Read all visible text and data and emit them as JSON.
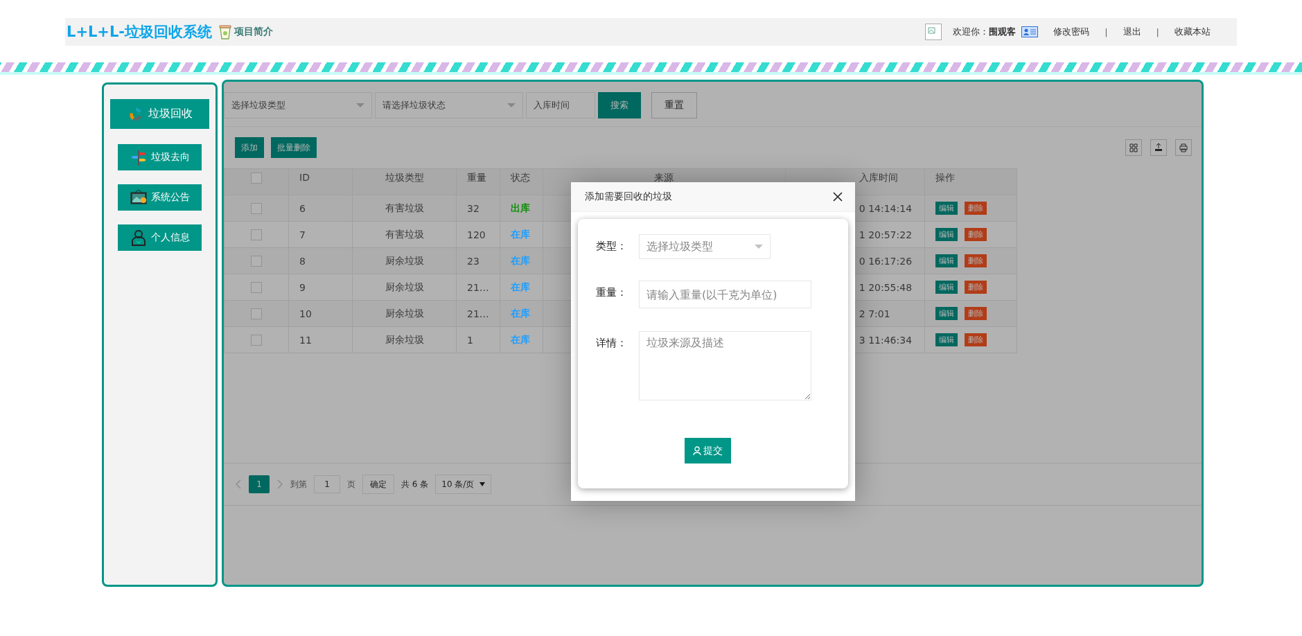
{
  "header": {
    "title": "L+L+L-垃圾回收系统",
    "intro_link": "项目简介",
    "welcome": "欢迎你：",
    "user": "围观客",
    "links": [
      "修改密码",
      "退出",
      "收藏本站"
    ],
    "separator": "|"
  },
  "sidebar": {
    "items": [
      {
        "label": "垃圾回收",
        "kind": "main"
      },
      {
        "label": "垃圾去向",
        "kind": "sub"
      },
      {
        "label": "系统公告",
        "kind": "sub"
      },
      {
        "label": "个人信息",
        "kind": "sub"
      }
    ]
  },
  "filters": {
    "type_placeholder": "选择垃圾类型",
    "status_placeholder": "请选择垃圾状态",
    "date_placeholder": "入库时间",
    "search": "搜索",
    "reset": "重置"
  },
  "toolbar": {
    "buttons": [
      "添加",
      "批量删除"
    ]
  },
  "table": {
    "all_checked": false,
    "columns": [
      "ID",
      "垃圾类型",
      "重量",
      "状态",
      "来源",
      "入库时间",
      "操作"
    ],
    "rows": [
      {
        "checked": false,
        "id": "6",
        "type": "有害垃圾",
        "weight": "32",
        "status": "出库",
        "color": "#0e8f08",
        "time": "0 14:14:14",
        "actions": [
          "编辑",
          "删除"
        ]
      },
      {
        "checked": false,
        "id": "7",
        "type": "有害垃圾",
        "weight": "120",
        "status": "在库",
        "color": "#1e9fff",
        "time": "1 20:57:22",
        "actions": [
          "编辑",
          "删除"
        ]
      },
      {
        "checked": false,
        "id": "8",
        "type": "厨余垃圾",
        "weight": "23",
        "status": "在库",
        "color": "#1e9fff",
        "time": "0 16:17:26",
        "actions": [
          "编辑",
          "删除"
        ]
      },
      {
        "checked": false,
        "id": "9",
        "type": "厨余垃圾",
        "weight": "21…",
        "status": "在库",
        "color": "#1e9fff",
        "time": "1 20:55:48",
        "actions": [
          "编辑",
          "删除"
        ]
      },
      {
        "checked": false,
        "id": "10",
        "type": "厨余垃圾",
        "weight": "21…",
        "status": "在库",
        "color": "#1e9fff",
        "time": "2 7:01",
        "actions": [
          "编辑",
          "删除"
        ]
      },
      {
        "checked": false,
        "id": "11",
        "type": "厨余垃圾",
        "weight": "1",
        "status": "在库",
        "color": "#1e9fff",
        "time": "3 11:46:34",
        "actions": [
          "编辑",
          "删除"
        ]
      }
    ]
  },
  "pagination": {
    "pages": [
      {
        "label": "1",
        "selected": true
      }
    ],
    "goto_label": "到第",
    "page_input": "1",
    "page_unit": "页",
    "confirm": "确定",
    "total": "共 6 条",
    "page_size": "10 条/页"
  },
  "dialog": {
    "title": "添加需要回收的垃圾",
    "fields": [
      {
        "label": "类型：",
        "kind": "select",
        "placeholder": "选择垃圾类型"
      },
      {
        "label": "重量：",
        "kind": "input",
        "placeholder": "请输入重量(以千克为单位)"
      },
      {
        "label": "详情：",
        "kind": "textarea",
        "placeholder": "垃圾来源及描述"
      }
    ],
    "submit": "提交"
  }
}
